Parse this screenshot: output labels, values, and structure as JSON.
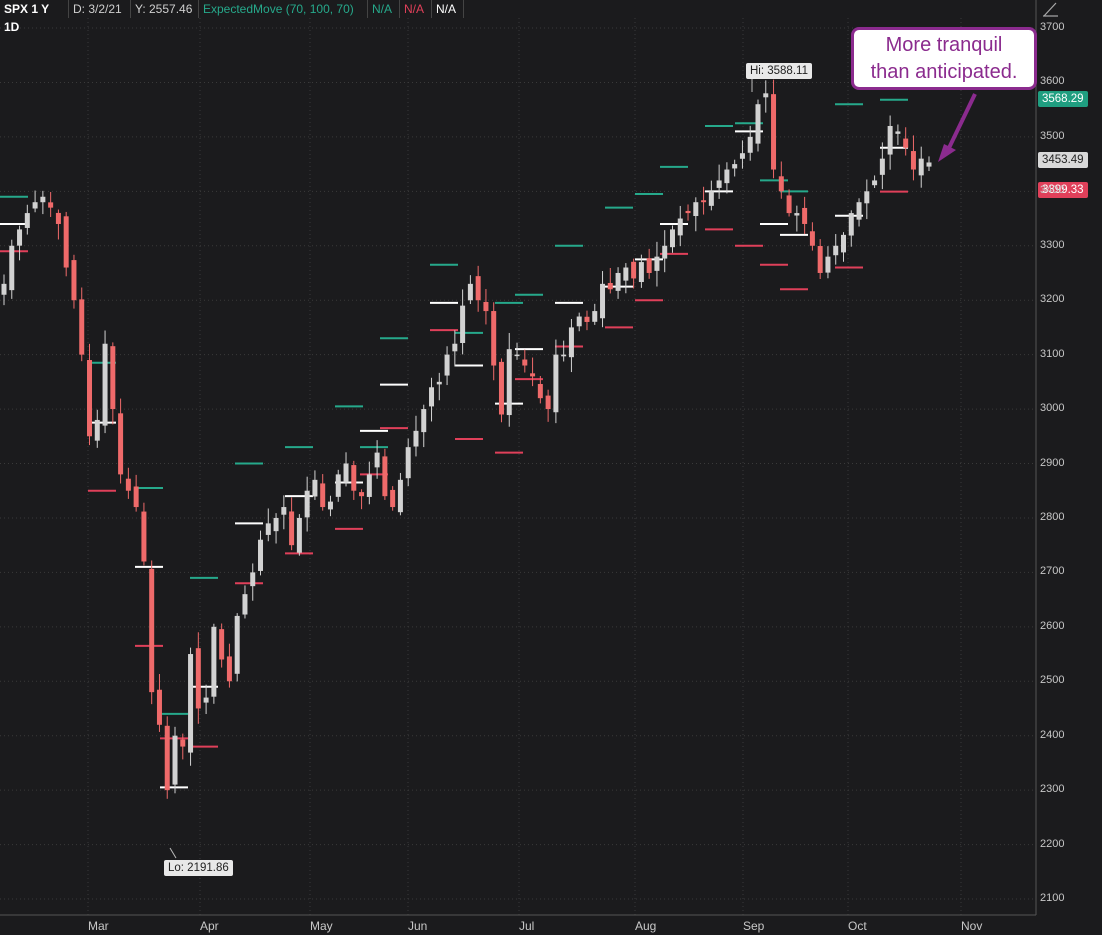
{
  "header": {
    "symbol": "SPX 1 Y 1D",
    "date": "D: 3/2/21",
    "y_readout": "Y: 2557.46",
    "study": "ExpectedMove (70, 100, 70)",
    "study_val1": "N/A",
    "study_val2": "N/A",
    "study_val3": "N/A"
  },
  "annotation": {
    "callout_line1": "More tranquil",
    "callout_line2": "than anticipated.",
    "hi_label": "Hi: 3588.11",
    "lo_label": "Lo: 2191.86"
  },
  "price_tags": {
    "upper_em": "3568.29",
    "last": "3453.49",
    "lower_em": "3399.33"
  },
  "colors": {
    "background": "#1b1b1d",
    "up_candle": "#d2d2d2",
    "down_candle": "#ef6a6a",
    "upper_em": "#26a98b",
    "lower_em": "#e0405a",
    "mid_em": "#ffffff",
    "callout": "#8b2b8e",
    "grid": "#3a3a3a"
  },
  "chart_data": {
    "type": "candlestick",
    "title": "SPX 1 Y 1D",
    "ylim": [
      2100,
      3700
    ],
    "y_ticks": [
      "2100",
      "2200",
      "2300",
      "2400",
      "2500",
      "2600",
      "2700",
      "2800",
      "2900",
      "3000",
      "3100",
      "3200",
      "3300",
      "3400",
      "3500",
      "3600",
      "3700"
    ],
    "x_ticks": [
      "Mar",
      "Apr",
      "May",
      "Jun",
      "Jul",
      "Aug",
      "Sep",
      "Oct",
      "Nov"
    ],
    "grid": true,
    "close_series": [
      3230,
      3300,
      3330,
      3360,
      3380,
      3390,
      3370,
      3340,
      3260,
      3200,
      3100,
      2950,
      2980,
      3120,
      3000,
      2880,
      2850,
      2820,
      2720,
      2480,
      2420,
      2300,
      2400,
      2380,
      2550,
      2450,
      2470,
      2600,
      2540,
      2500,
      2620,
      2660,
      2700,
      2760,
      2790,
      2800,
      2820,
      2750,
      2800,
      2850,
      2870,
      2820,
      2830,
      2880,
      2900,
      2850,
      2840,
      2880,
      2920,
      2840,
      2820,
      2870,
      2930,
      2960,
      3000,
      3040,
      3050,
      3100,
      3120,
      3190,
      3230,
      3200,
      3180,
      3080,
      2990,
      3110,
      3100,
      3080,
      3060,
      3020,
      3000,
      3100,
      3100,
      3150,
      3170,
      3160,
      3180,
      3230,
      3220,
      3250,
      3260,
      3240,
      3270,
      3250,
      3280,
      3300,
      3330,
      3350,
      3360,
      3380,
      3380,
      3400,
      3420,
      3440,
      3450,
      3470,
      3500,
      3560,
      3580,
      3440,
      3400,
      3360,
      3360,
      3340,
      3300,
      3250,
      3280,
      3300,
      3320,
      3360,
      3380,
      3400,
      3420,
      3460,
      3520,
      3510,
      3480,
      3440,
      3460,
      3453
    ],
    "expected_move_levels": [
      {
        "start": "Feb",
        "upper": 3390,
        "mid": 3340,
        "lower": 3290
      },
      {
        "start": "Mar",
        "upper": 3085,
        "mid": 2975,
        "lower": 2850
      },
      {
        "start": "Mar",
        "upper": 2855,
        "mid": 2710,
        "lower": 2565
      },
      {
        "start": "Mar",
        "upper": 2440,
        "mid": 2305,
        "lower": 2395
      },
      {
        "start": "Apr",
        "upper": 2690,
        "mid": 2490,
        "lower": 2380
      },
      {
        "start": "Apr",
        "upper": 2900,
        "mid": 2790,
        "lower": 2680
      },
      {
        "start": "May",
        "upper": 2930,
        "mid": 2840,
        "lower": 2735
      },
      {
        "start": "May",
        "upper": 3005,
        "mid": 2865,
        "lower": 2780
      },
      {
        "start": "May",
        "upper": 2930,
        "mid": 2960,
        "lower": 2880
      },
      {
        "start": "Jun",
        "upper": 3130,
        "mid": 3045,
        "lower": 2965
      },
      {
        "start": "Jun",
        "upper": 3265,
        "mid": 3195,
        "lower": 3145
      },
      {
        "start": "Jun",
        "upper": 3140,
        "mid": 3080,
        "lower": 2945
      },
      {
        "start": "Jul",
        "upper": 3195,
        "mid": 3010,
        "lower": 2920
      },
      {
        "start": "Jul",
        "upper": 3210,
        "mid": 3110,
        "lower": 3055
      },
      {
        "start": "Jul",
        "upper": 3300,
        "mid": 3195,
        "lower": 3115
      },
      {
        "start": "Aug",
        "upper": 3370,
        "mid": 3225,
        "lower": 3150
      },
      {
        "start": "Aug",
        "upper": 3395,
        "mid": 3275,
        "lower": 3200
      },
      {
        "start": "Aug",
        "upper": 3445,
        "mid": 3340,
        "lower": 3285
      },
      {
        "start": "Aug",
        "upper": 3520,
        "mid": 3400,
        "lower": 3330
      },
      {
        "start": "Sep",
        "upper": 3525,
        "mid": 3510,
        "lower": 3300
      },
      {
        "start": "Sep",
        "upper": 3420,
        "mid": 3340,
        "lower": 3265
      },
      {
        "start": "Sep",
        "upper": 3400,
        "mid": 3320,
        "lower": 3220
      },
      {
        "start": "Oct",
        "upper": 3560,
        "mid": 3355,
        "lower": 3260
      },
      {
        "start": "Oct",
        "upper": 3568.29,
        "mid": 3480,
        "lower": 3399.33
      }
    ]
  }
}
